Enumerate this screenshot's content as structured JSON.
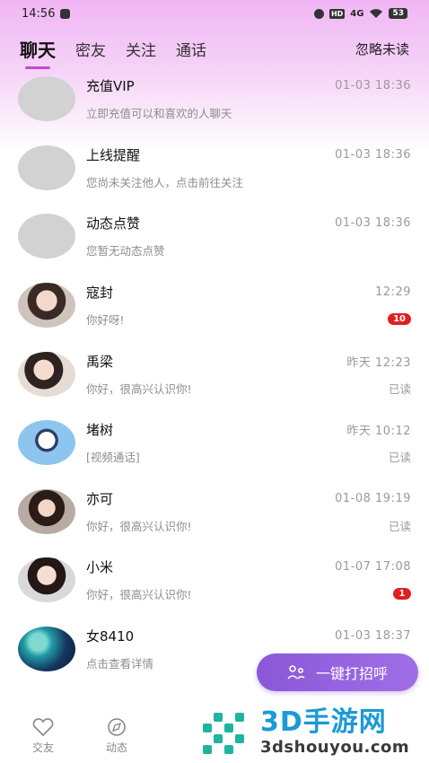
{
  "status_bar": {
    "time": "14:56",
    "hd": "HD",
    "network": "4G",
    "battery": "53"
  },
  "tabs": [
    {
      "label": "聊天",
      "active": true
    },
    {
      "label": "密友",
      "active": false
    },
    {
      "label": "关注",
      "active": false
    },
    {
      "label": "通话",
      "active": false
    }
  ],
  "ignore_unread": "忽略未读",
  "conversations": [
    {
      "name": "充值VIP",
      "preview": "立即充值可以和喜欢的人聊天",
      "time": "01-03 18:36",
      "status": "",
      "badge": ""
    },
    {
      "name": "上线提醒",
      "preview": "您尚未关注他人，点击前往关注",
      "time": "01-03 18:36",
      "status": "",
      "badge": ""
    },
    {
      "name": "动态点赞",
      "preview": "您暂无动态点赞",
      "time": "01-03 18:36",
      "status": "",
      "badge": ""
    },
    {
      "name": "寇封",
      "preview": "你好呀!",
      "time": "12:29",
      "status": "",
      "badge": "10"
    },
    {
      "name": "禹梁",
      "preview": "你好，很高兴认识你!",
      "time": "昨天 12:23",
      "status": "已读",
      "badge": ""
    },
    {
      "name": "堵树",
      "preview": "[视频通话]",
      "time": "昨天 10:12",
      "status": "已读",
      "badge": ""
    },
    {
      "name": "亦可",
      "preview": "你好，很高兴认识你!",
      "time": "01-08 19:19",
      "status": "已读",
      "badge": ""
    },
    {
      "name": "小米",
      "preview": "你好，很高兴认识你!",
      "time": "01-07 17:08",
      "status": "",
      "badge": "1"
    },
    {
      "name": "女8410",
      "preview": "点击查看详情",
      "time": "01-03 18:37",
      "status": "",
      "badge": ""
    }
  ],
  "fab_label": "一键打招呼",
  "bottom_nav": [
    {
      "label": "交友",
      "icon": "heart-icon"
    },
    {
      "label": "动态",
      "icon": "compass-icon"
    }
  ],
  "watermark": {
    "title": "3D手游网",
    "subtitle": "3dshouyou.com"
  },
  "colors": {
    "accent": "#c04ccc",
    "fab": "#9462de",
    "badge": "#e02020",
    "watermark": "#1b9ad6"
  }
}
